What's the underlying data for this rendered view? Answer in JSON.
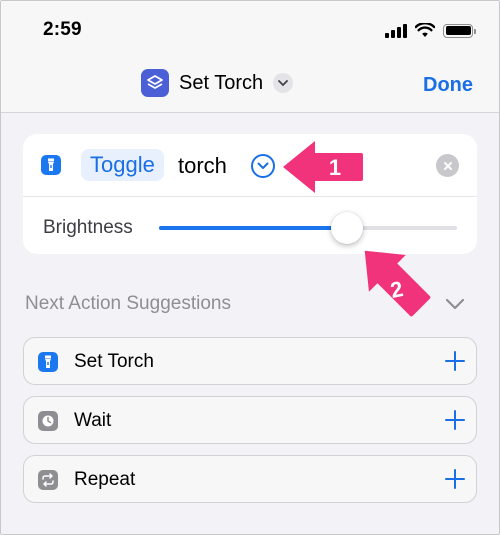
{
  "status_bar": {
    "time": "2:59"
  },
  "nav": {
    "title": "Set Torch",
    "done_label": "Done"
  },
  "action": {
    "toggle_label": "Toggle",
    "object_label": "torch",
    "brightness_label": "Brightness",
    "brightness_value": 0.63
  },
  "suggestions": {
    "header": "Next Action Suggestions",
    "items": [
      {
        "label": "Set Torch",
        "icon": "torch-icon",
        "color": "#1b78f0"
      },
      {
        "label": "Wait",
        "icon": "clock-icon",
        "color": "#8e8e93"
      },
      {
        "label": "Repeat",
        "icon": "repeat-icon",
        "color": "#8e8e93"
      }
    ]
  },
  "annotations": {
    "arrow1": "1",
    "arrow2": "2"
  },
  "colors": {
    "accent": "#1a6fe6",
    "annotation": "#f0337a"
  }
}
